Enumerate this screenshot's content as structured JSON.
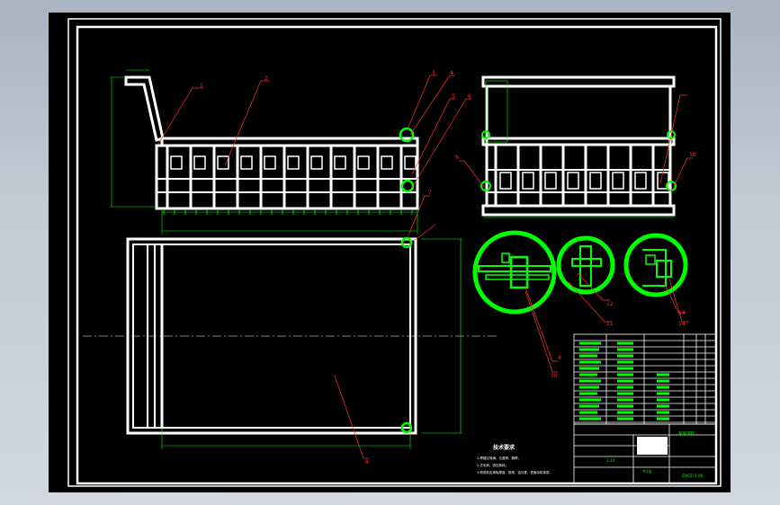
{
  "colors": {
    "background": "#000000",
    "geometry": "#ffffff",
    "dimension": "#00ff00",
    "leader": "#ff3030"
  },
  "balloons": [
    "1",
    "2",
    "3",
    "4",
    "5",
    "6",
    "7",
    "8",
    "9",
    "10",
    "11",
    "12",
    "13",
    "14",
    "9",
    "10"
  ],
  "tech_requirements": {
    "title": "技术要求",
    "items": [
      "1.焊缝应饱满，无虚焊、漏焊；",
      "2.去毛刺，锐边倒钝；",
      "3.喷漆前应清除焊渣、铁锈、油污等，表面涂防锈漆。"
    ]
  },
  "title_block": {
    "company": "某某学院",
    "drawing_no": "ZXGT-2-00",
    "scale": "1:10",
    "sheet": "共1张"
  }
}
